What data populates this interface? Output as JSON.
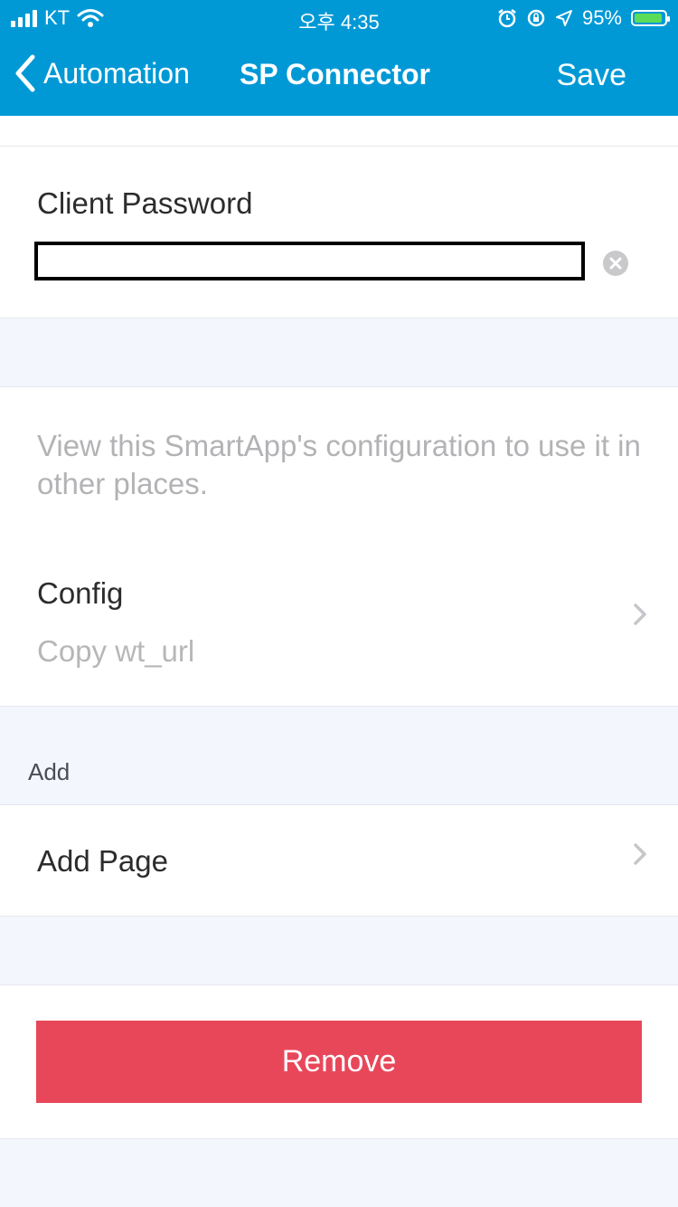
{
  "status_bar": {
    "carrier": "KT",
    "time": "오후 4:35",
    "battery_percent": "95%",
    "battery_level": 0.95
  },
  "nav": {
    "back_label": "Automation",
    "title": "SP Connector",
    "save_label": "Save"
  },
  "client_password": {
    "label": "Client Password",
    "value": ""
  },
  "config_section": {
    "hint": "View this SmartApp's configuration to use it in other places.",
    "config_label": "Config",
    "config_sub": "Copy wt_url"
  },
  "add_section": {
    "header": "Add",
    "add_page_label": "Add Page"
  },
  "remove_button_label": "Remove",
  "colors": {
    "header_bg": "#0099d6",
    "remove_bg": "#e8475a",
    "page_bg": "#f3f6fd"
  },
  "icons": {
    "back": "chevron-left-icon",
    "clear": "clear-circle-icon",
    "disclosure": "chevron-right-icon",
    "wifi": "wifi-icon",
    "alarm": "alarm-icon",
    "location": "location-arrow-icon",
    "rotation_lock": "rotation-lock-icon",
    "battery": "battery-icon"
  }
}
